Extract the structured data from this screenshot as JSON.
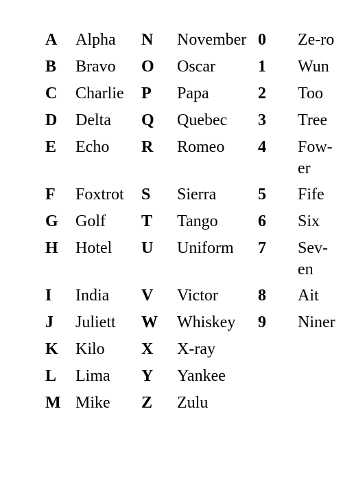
{
  "rows": [
    {
      "l1": "A",
      "w1": "Alpha",
      "l2": "N",
      "w2": "November",
      "l3": "0",
      "w3": "Ze-ro"
    },
    {
      "l1": "B",
      "w1": "Bravo",
      "l2": "O",
      "w2": "Oscar",
      "l3": "1",
      "w3": "Wun"
    },
    {
      "l1": "C",
      "w1": "Charlie",
      "l2": "P",
      "w2": "Papa",
      "l3": "2",
      "w3": "Too"
    },
    {
      "l1": "D",
      "w1": "Delta",
      "l2": "Q",
      "w2": "Quebec",
      "l3": "3",
      "w3": "Tree"
    },
    {
      "l1": "E",
      "w1": "Echo",
      "l2": "R",
      "w2": "Romeo",
      "l3": "4",
      "w3": "Fow-\ner"
    },
    {
      "l1": "F",
      "w1": "Foxtrot",
      "l2": "S",
      "w2": "Sierra",
      "l3": "5",
      "w3": "Fife"
    },
    {
      "l1": "G",
      "w1": "Golf",
      "l2": "T",
      "w2": "Tango",
      "l3": "6",
      "w3": "Six"
    },
    {
      "l1": "H",
      "w1": "Hotel",
      "l2": "U",
      "w2": "Uniform",
      "l3": "7",
      "w3": "Sev-\nen"
    },
    {
      "l1": "I",
      "w1": "India",
      "l2": "V",
      "w2": "Victor",
      "l3": "8",
      "w3": "Ait"
    },
    {
      "l1": "J",
      "w1": "Juliett",
      "l2": "W",
      "w2": "Whiskey",
      "l3": "9",
      "w3": "Niner"
    },
    {
      "l1": "K",
      "w1": "Kilo",
      "l2": "X",
      "w2": "X-ray"
    },
    {
      "l1": "L",
      "w1": "Lima",
      "l2": "Y",
      "w2": "Yankee"
    },
    {
      "l1": "M",
      "w1": "Mike",
      "l2": "Z",
      "w2": "Zulu"
    }
  ]
}
